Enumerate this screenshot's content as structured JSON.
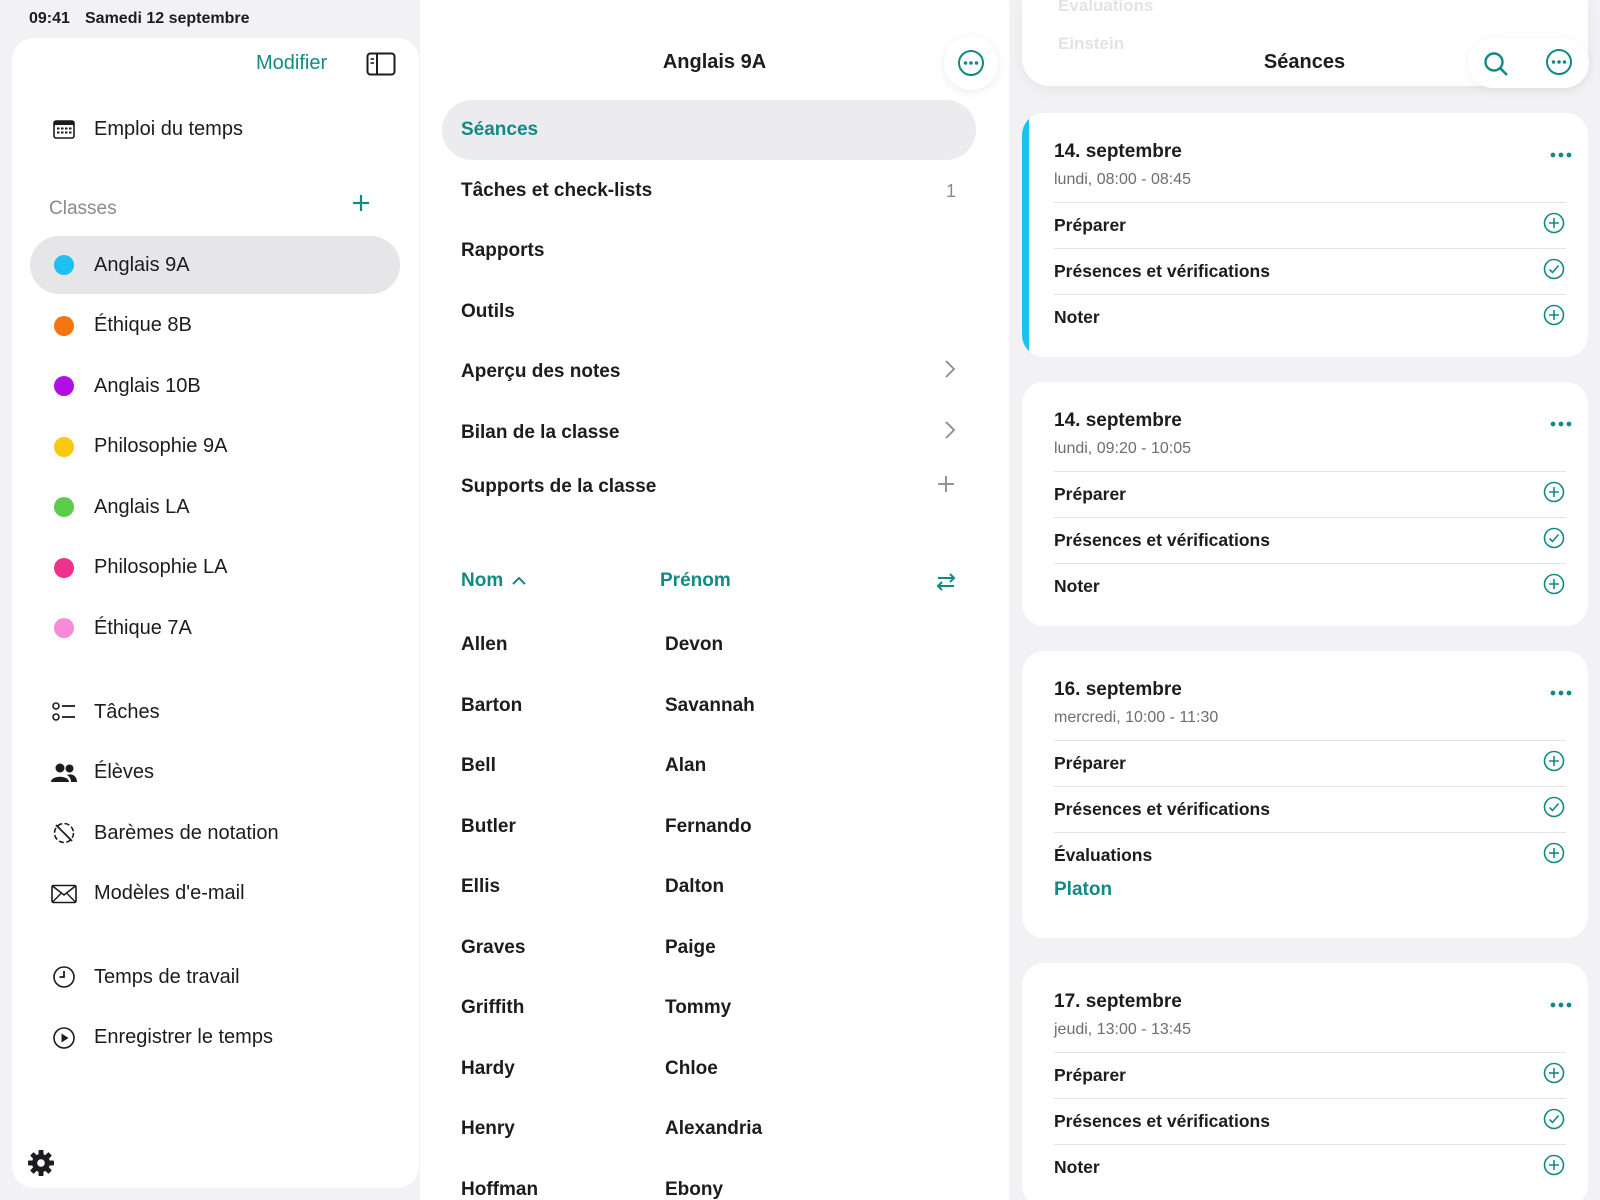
{
  "status": {
    "time": "09:41",
    "date": "Samedi 12 septembre"
  },
  "sidebar": {
    "edit_label": "Modifier",
    "timetable_label": "Emploi du temps",
    "classes_header": "Classes",
    "classes": [
      {
        "label": "Anglais 9A",
        "color": "#1ec0f0"
      },
      {
        "label": "Éthique 8B",
        "color": "#f5750f"
      },
      {
        "label": "Anglais 10B",
        "color": "#b10fe6"
      },
      {
        "label": "Philosophie 9A",
        "color": "#fcc80f"
      },
      {
        "label": "Anglais LA",
        "color": "#5ccc4a"
      },
      {
        "label": "Philosophie LA",
        "color": "#f0308e"
      },
      {
        "label": "Éthique 7A",
        "color": "#f98ad8"
      }
    ],
    "tools": [
      {
        "label": "Tâches",
        "icon": "tasks-icon"
      },
      {
        "label": "Élèves",
        "icon": "students-icon"
      },
      {
        "label": "Barèmes de notation",
        "icon": "grading-scale-icon"
      },
      {
        "label": "Modèles d'e-mail",
        "icon": "mail-icon"
      }
    ],
    "time_items": [
      {
        "label": "Temps de travail",
        "icon": "clock-icon"
      },
      {
        "label": "Enregistrer le temps",
        "icon": "play-icon"
      }
    ]
  },
  "middle": {
    "title": "Anglais 9A",
    "menu": [
      {
        "label": "Séances",
        "count": "",
        "accessory": "none"
      },
      {
        "label": "Tâches et check-lists",
        "count": "1",
        "accessory": "none"
      },
      {
        "label": "Rapports",
        "count": "",
        "accessory": "none"
      },
      {
        "label": "Outils",
        "count": "",
        "accessory": "none"
      },
      {
        "label": "Aperçu des notes",
        "count": "",
        "accessory": "chevron"
      },
      {
        "label": "Bilan de la classe",
        "count": "",
        "accessory": "chevron"
      },
      {
        "label": "Supports de la classe",
        "count": "",
        "accessory": "plus"
      }
    ],
    "list_headers": {
      "last": "Nom",
      "first": "Prénom"
    },
    "students": [
      {
        "last": "Allen",
        "first": "Devon"
      },
      {
        "last": "Barton",
        "first": "Savannah"
      },
      {
        "last": "Bell",
        "first": "Alan"
      },
      {
        "last": "Butler",
        "first": "Fernando"
      },
      {
        "last": "Ellis",
        "first": "Dalton"
      },
      {
        "last": "Graves",
        "first": "Paige"
      },
      {
        "last": "Griffith",
        "first": "Tommy"
      },
      {
        "last": "Hardy",
        "first": "Chloe"
      },
      {
        "last": "Henry",
        "first": "Alexandria"
      },
      {
        "last": "Hoffman",
        "first": "Ebony"
      }
    ]
  },
  "right": {
    "title": "Séances",
    "ghost_texts": [
      "Évaluations",
      "Einstein"
    ],
    "sessions": [
      {
        "date": "14. septembre",
        "time": "lundi, 08:00 - 08:45",
        "rows": [
          {
            "label": "Préparer",
            "icon": "plus-circle-icon"
          },
          {
            "label": "Présences et vérifications",
            "icon": "check-circle-icon"
          },
          {
            "label": "Noter",
            "icon": "plus-circle-icon"
          }
        ],
        "link": ""
      },
      {
        "date": "14. septembre",
        "time": "lundi, 09:20 - 10:05",
        "rows": [
          {
            "label": "Préparer",
            "icon": "plus-circle-icon"
          },
          {
            "label": "Présences et vérifications",
            "icon": "check-circle-icon"
          },
          {
            "label": "Noter",
            "icon": "plus-circle-icon"
          }
        ],
        "link": ""
      },
      {
        "date": "16. septembre",
        "time": "mercredi, 10:00 - 11:30",
        "rows": [
          {
            "label": "Préparer",
            "icon": "plus-circle-icon"
          },
          {
            "label": "Présences et vérifications",
            "icon": "check-circle-icon"
          },
          {
            "label": "Évaluations",
            "icon": "plus-circle-icon"
          }
        ],
        "link": "Platon"
      },
      {
        "date": "17. septembre",
        "time": "jeudi, 13:00 - 13:45",
        "rows": [
          {
            "label": "Préparer",
            "icon": "plus-circle-icon"
          },
          {
            "label": "Présences et vérifications",
            "icon": "check-circle-icon"
          },
          {
            "label": "Noter",
            "icon": "plus-circle-icon"
          }
        ],
        "link": ""
      }
    ]
  },
  "colors": {
    "accent": "#128a84",
    "selected_bar": "#1ec0f0"
  }
}
